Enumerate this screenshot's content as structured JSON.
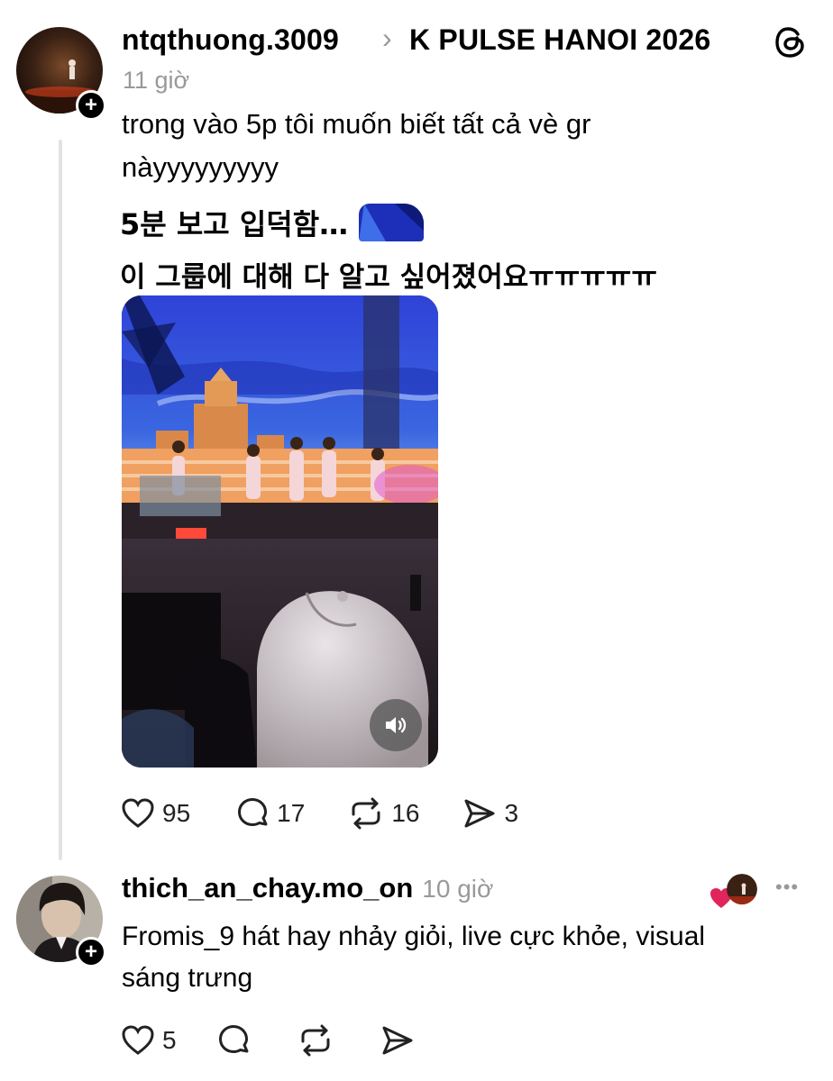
{
  "post": {
    "username": "ntqthuong.3009",
    "separator": "›",
    "community": "K PULSE HANOI 2026",
    "time": "11 giờ",
    "text_line1": "trong vào 5p tôi muốn biết tất cả vè gr",
    "text_line2": "nàyyyyyyyyy",
    "korean_line1": "5분 보고 입덕함…",
    "korean_line2": "이 그룹에 대해 다 알고 싶어졌어요ㅠㅠㅠㅠㅠ",
    "media": {
      "type": "video",
      "sound_icon": "speaker-icon"
    },
    "likes": "95",
    "comments": "17",
    "reposts": "16",
    "shares": "3"
  },
  "reply": {
    "username": "thich_an_chay.mo_on",
    "time": "10 giờ",
    "text_line1": "Fromis_9 hát hay nhảy giỏi, live cực khỏe, visual",
    "text_line2": "sáng trưng",
    "likes": "5",
    "more_label": "•••"
  },
  "icons": [
    "threads-logo-icon",
    "heart-icon",
    "comment-icon",
    "repost-icon",
    "send-icon",
    "speaker-icon",
    "plus-icon",
    "more-icon"
  ],
  "colors": {
    "text": "#000000",
    "muted": "#999999",
    "liked_heart": "#e0245e",
    "thread_line": "#e2e2e2"
  }
}
